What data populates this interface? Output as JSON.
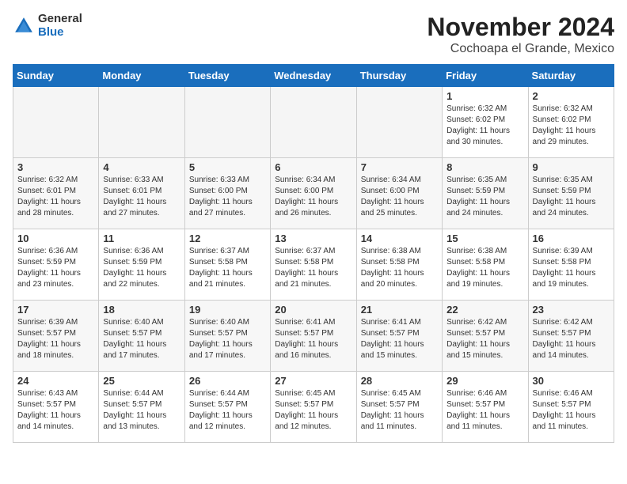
{
  "logo": {
    "general": "General",
    "blue": "Blue"
  },
  "title": "November 2024",
  "subtitle": "Cochoapa el Grande, Mexico",
  "days_header": [
    "Sunday",
    "Monday",
    "Tuesday",
    "Wednesday",
    "Thursday",
    "Friday",
    "Saturday"
  ],
  "weeks": [
    [
      {
        "day": "",
        "empty": true
      },
      {
        "day": "",
        "empty": true
      },
      {
        "day": "",
        "empty": true
      },
      {
        "day": "",
        "empty": true
      },
      {
        "day": "",
        "empty": true
      },
      {
        "day": "1",
        "sunrise": "6:32 AM",
        "sunset": "6:02 PM",
        "daylight": "11 hours and 30 minutes."
      },
      {
        "day": "2",
        "sunrise": "6:32 AM",
        "sunset": "6:02 PM",
        "daylight": "11 hours and 29 minutes."
      }
    ],
    [
      {
        "day": "3",
        "sunrise": "6:32 AM",
        "sunset": "6:01 PM",
        "daylight": "11 hours and 28 minutes."
      },
      {
        "day": "4",
        "sunrise": "6:33 AM",
        "sunset": "6:01 PM",
        "daylight": "11 hours and 27 minutes."
      },
      {
        "day": "5",
        "sunrise": "6:33 AM",
        "sunset": "6:00 PM",
        "daylight": "11 hours and 27 minutes."
      },
      {
        "day": "6",
        "sunrise": "6:34 AM",
        "sunset": "6:00 PM",
        "daylight": "11 hours and 26 minutes."
      },
      {
        "day": "7",
        "sunrise": "6:34 AM",
        "sunset": "6:00 PM",
        "daylight": "11 hours and 25 minutes."
      },
      {
        "day": "8",
        "sunrise": "6:35 AM",
        "sunset": "5:59 PM",
        "daylight": "11 hours and 24 minutes."
      },
      {
        "day": "9",
        "sunrise": "6:35 AM",
        "sunset": "5:59 PM",
        "daylight": "11 hours and 24 minutes."
      }
    ],
    [
      {
        "day": "10",
        "sunrise": "6:36 AM",
        "sunset": "5:59 PM",
        "daylight": "11 hours and 23 minutes."
      },
      {
        "day": "11",
        "sunrise": "6:36 AM",
        "sunset": "5:59 PM",
        "daylight": "11 hours and 22 minutes."
      },
      {
        "day": "12",
        "sunrise": "6:37 AM",
        "sunset": "5:58 PM",
        "daylight": "11 hours and 21 minutes."
      },
      {
        "day": "13",
        "sunrise": "6:37 AM",
        "sunset": "5:58 PM",
        "daylight": "11 hours and 21 minutes."
      },
      {
        "day": "14",
        "sunrise": "6:38 AM",
        "sunset": "5:58 PM",
        "daylight": "11 hours and 20 minutes."
      },
      {
        "day": "15",
        "sunrise": "6:38 AM",
        "sunset": "5:58 PM",
        "daylight": "11 hours and 19 minutes."
      },
      {
        "day": "16",
        "sunrise": "6:39 AM",
        "sunset": "5:58 PM",
        "daylight": "11 hours and 19 minutes."
      }
    ],
    [
      {
        "day": "17",
        "sunrise": "6:39 AM",
        "sunset": "5:57 PM",
        "daylight": "11 hours and 18 minutes."
      },
      {
        "day": "18",
        "sunrise": "6:40 AM",
        "sunset": "5:57 PM",
        "daylight": "11 hours and 17 minutes."
      },
      {
        "day": "19",
        "sunrise": "6:40 AM",
        "sunset": "5:57 PM",
        "daylight": "11 hours and 17 minutes."
      },
      {
        "day": "20",
        "sunrise": "6:41 AM",
        "sunset": "5:57 PM",
        "daylight": "11 hours and 16 minutes."
      },
      {
        "day": "21",
        "sunrise": "6:41 AM",
        "sunset": "5:57 PM",
        "daylight": "11 hours and 15 minutes."
      },
      {
        "day": "22",
        "sunrise": "6:42 AM",
        "sunset": "5:57 PM",
        "daylight": "11 hours and 15 minutes."
      },
      {
        "day": "23",
        "sunrise": "6:42 AM",
        "sunset": "5:57 PM",
        "daylight": "11 hours and 14 minutes."
      }
    ],
    [
      {
        "day": "24",
        "sunrise": "6:43 AM",
        "sunset": "5:57 PM",
        "daylight": "11 hours and 14 minutes."
      },
      {
        "day": "25",
        "sunrise": "6:44 AM",
        "sunset": "5:57 PM",
        "daylight": "11 hours and 13 minutes."
      },
      {
        "day": "26",
        "sunrise": "6:44 AM",
        "sunset": "5:57 PM",
        "daylight": "11 hours and 12 minutes."
      },
      {
        "day": "27",
        "sunrise": "6:45 AM",
        "sunset": "5:57 PM",
        "daylight": "11 hours and 12 minutes."
      },
      {
        "day": "28",
        "sunrise": "6:45 AM",
        "sunset": "5:57 PM",
        "daylight": "11 hours and 11 minutes."
      },
      {
        "day": "29",
        "sunrise": "6:46 AM",
        "sunset": "5:57 PM",
        "daylight": "11 hours and 11 minutes."
      },
      {
        "day": "30",
        "sunrise": "6:46 AM",
        "sunset": "5:57 PM",
        "daylight": "11 hours and 11 minutes."
      }
    ]
  ]
}
